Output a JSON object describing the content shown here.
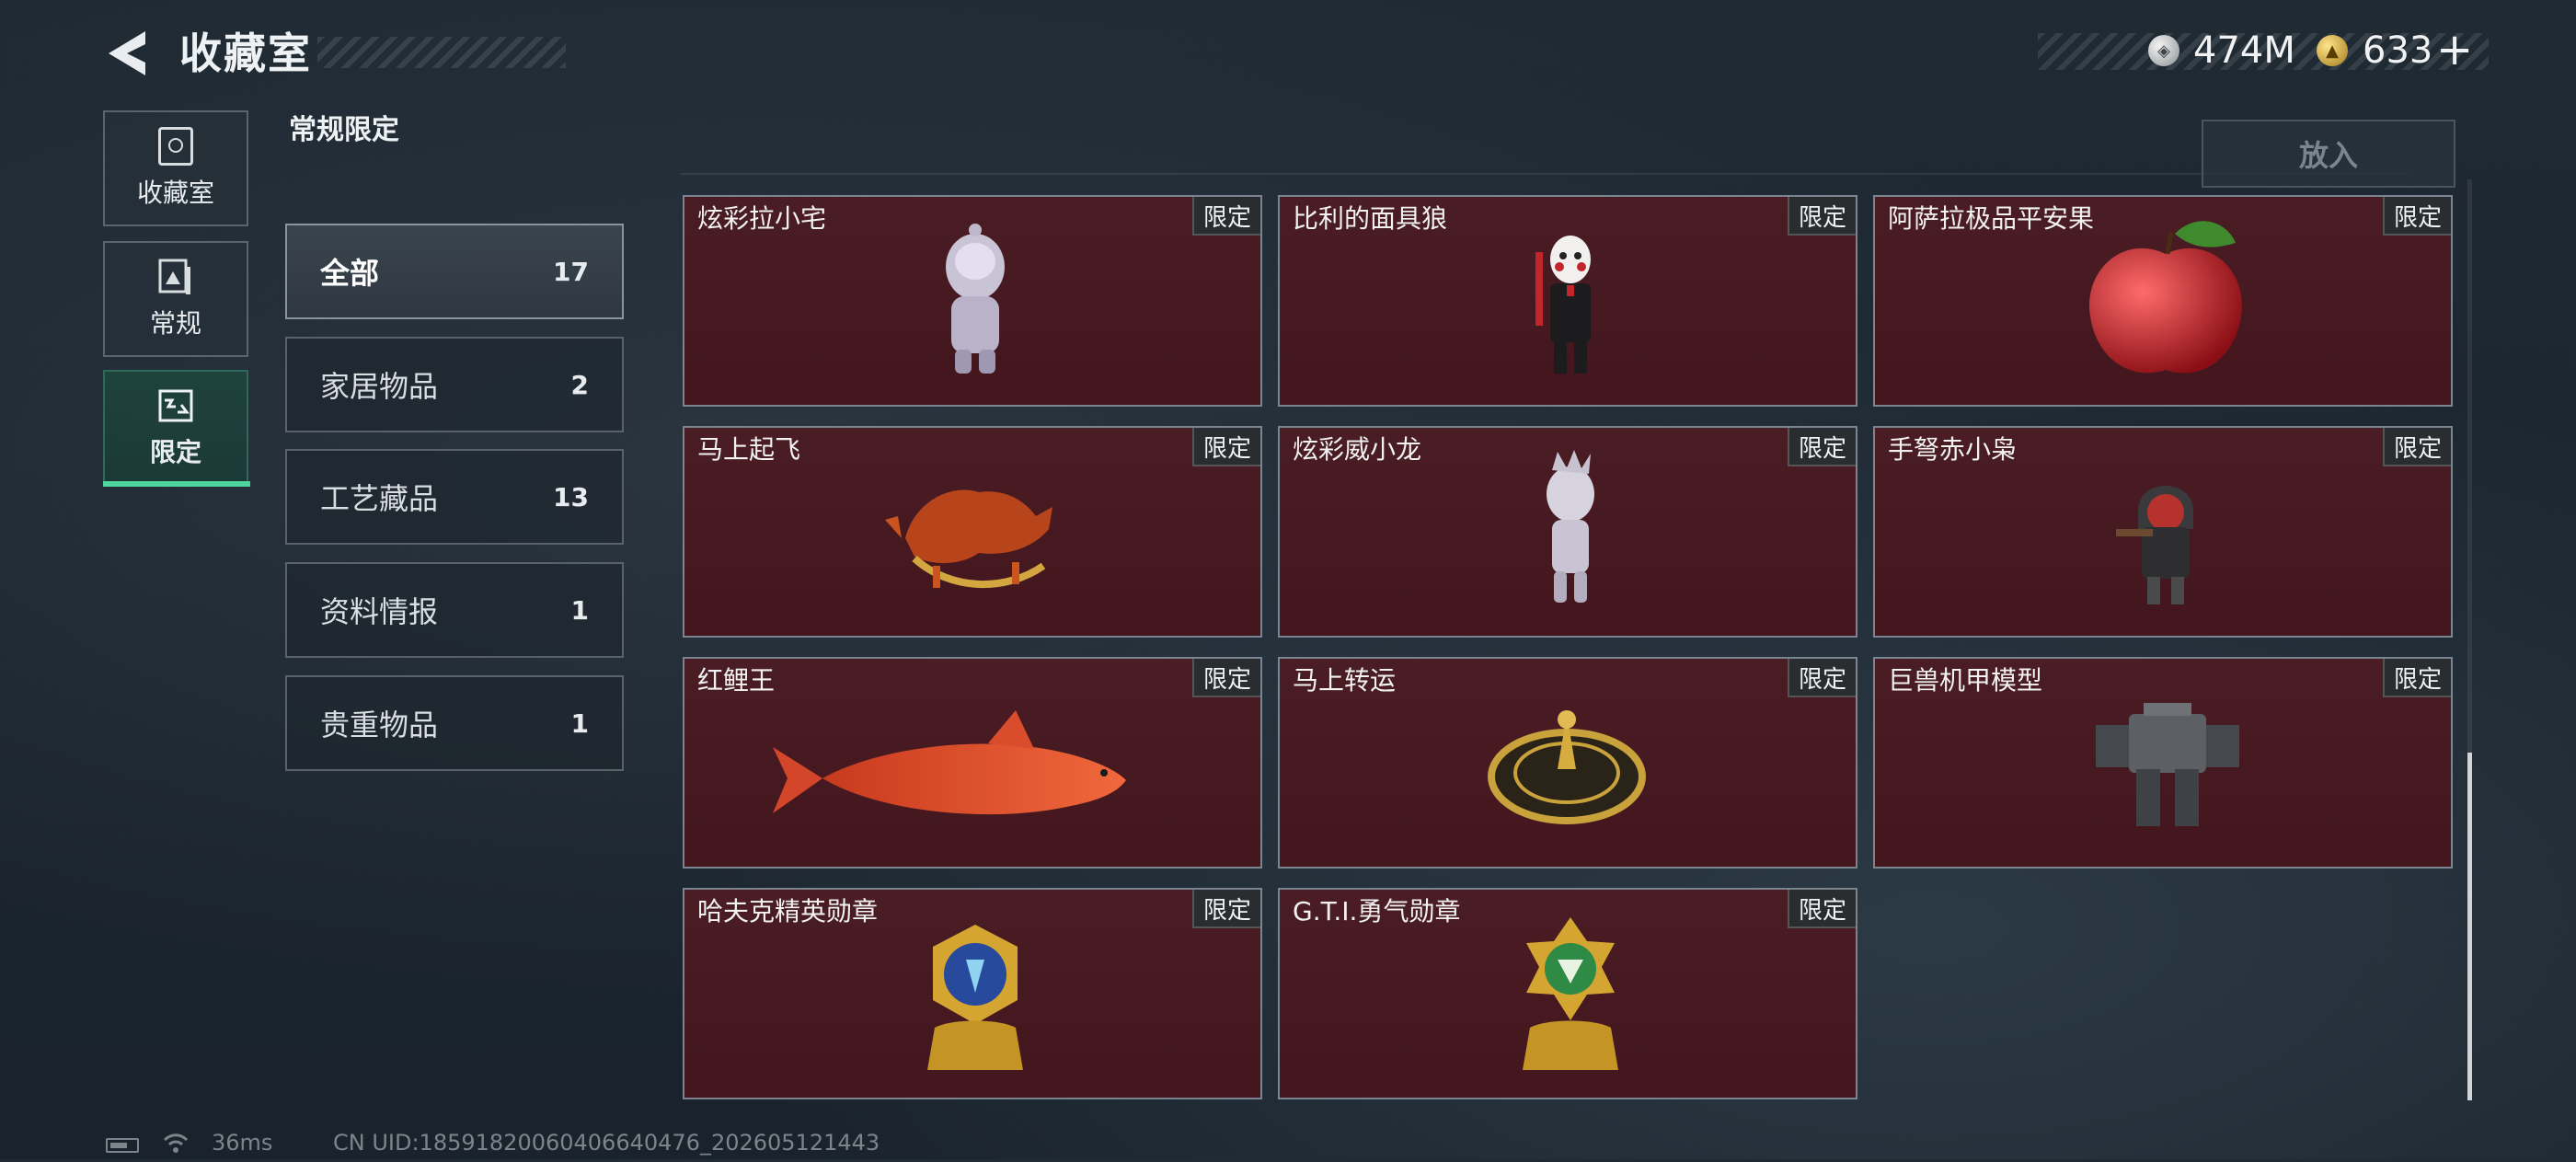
{
  "header": {
    "title": "收藏室",
    "silver_icon_glyph": "◈",
    "silver_value": "474M",
    "gold_icon_glyph": "▲",
    "gold_value": "633",
    "plus_label": "+"
  },
  "nav": {
    "items": [
      {
        "label": "收藏室",
        "icon": "vault-icon"
      },
      {
        "label": "常规",
        "icon": "picture-icon"
      },
      {
        "label": "限定",
        "icon": "limited-icon"
      }
    ],
    "active_index": 2
  },
  "section": {
    "title": "常规限定"
  },
  "categories": [
    {
      "label": "全部",
      "count": "17"
    },
    {
      "label": "家居物品",
      "count": "2"
    },
    {
      "label": "工艺藏品",
      "count": "13"
    },
    {
      "label": "资料情报",
      "count": "1"
    },
    {
      "label": "贵重物品",
      "count": "1"
    }
  ],
  "active_category": 0,
  "put_in_label": "放入",
  "items": [
    {
      "name": "炫彩拉小宅",
      "badge": "限定",
      "art": "doll-figure"
    },
    {
      "name": "比利的面具狼",
      "badge": "限定",
      "art": "puppet-figure"
    },
    {
      "name": "阿萨拉极品平安果",
      "badge": "限定",
      "art": "apple"
    },
    {
      "name": "马上起飞",
      "badge": "限定",
      "art": "rocking-horse"
    },
    {
      "name": "炫彩威小龙",
      "badge": "限定",
      "art": "silver-figure"
    },
    {
      "name": "手弩赤小枭",
      "badge": "限定",
      "art": "hooded-figure"
    },
    {
      "name": "红鲤王",
      "badge": "限定",
      "art": "koi-fish"
    },
    {
      "name": "马上转运",
      "badge": "限定",
      "art": "compass-disc"
    },
    {
      "name": "巨兽机甲模型",
      "badge": "限定",
      "art": "mech-model"
    },
    {
      "name": "哈夫克精英勋章",
      "badge": "限定",
      "art": "medal-blue"
    },
    {
      "name": "G.T.I.勇气勋章",
      "badge": "限定",
      "art": "medal-green"
    }
  ],
  "status": {
    "ping": "36ms",
    "uid": "CN UID:18591820060406640476_202605121443"
  },
  "colors": {
    "accent": "#4fd6a0",
    "card_bg": "#471a22",
    "card_border": "#7a8591"
  }
}
